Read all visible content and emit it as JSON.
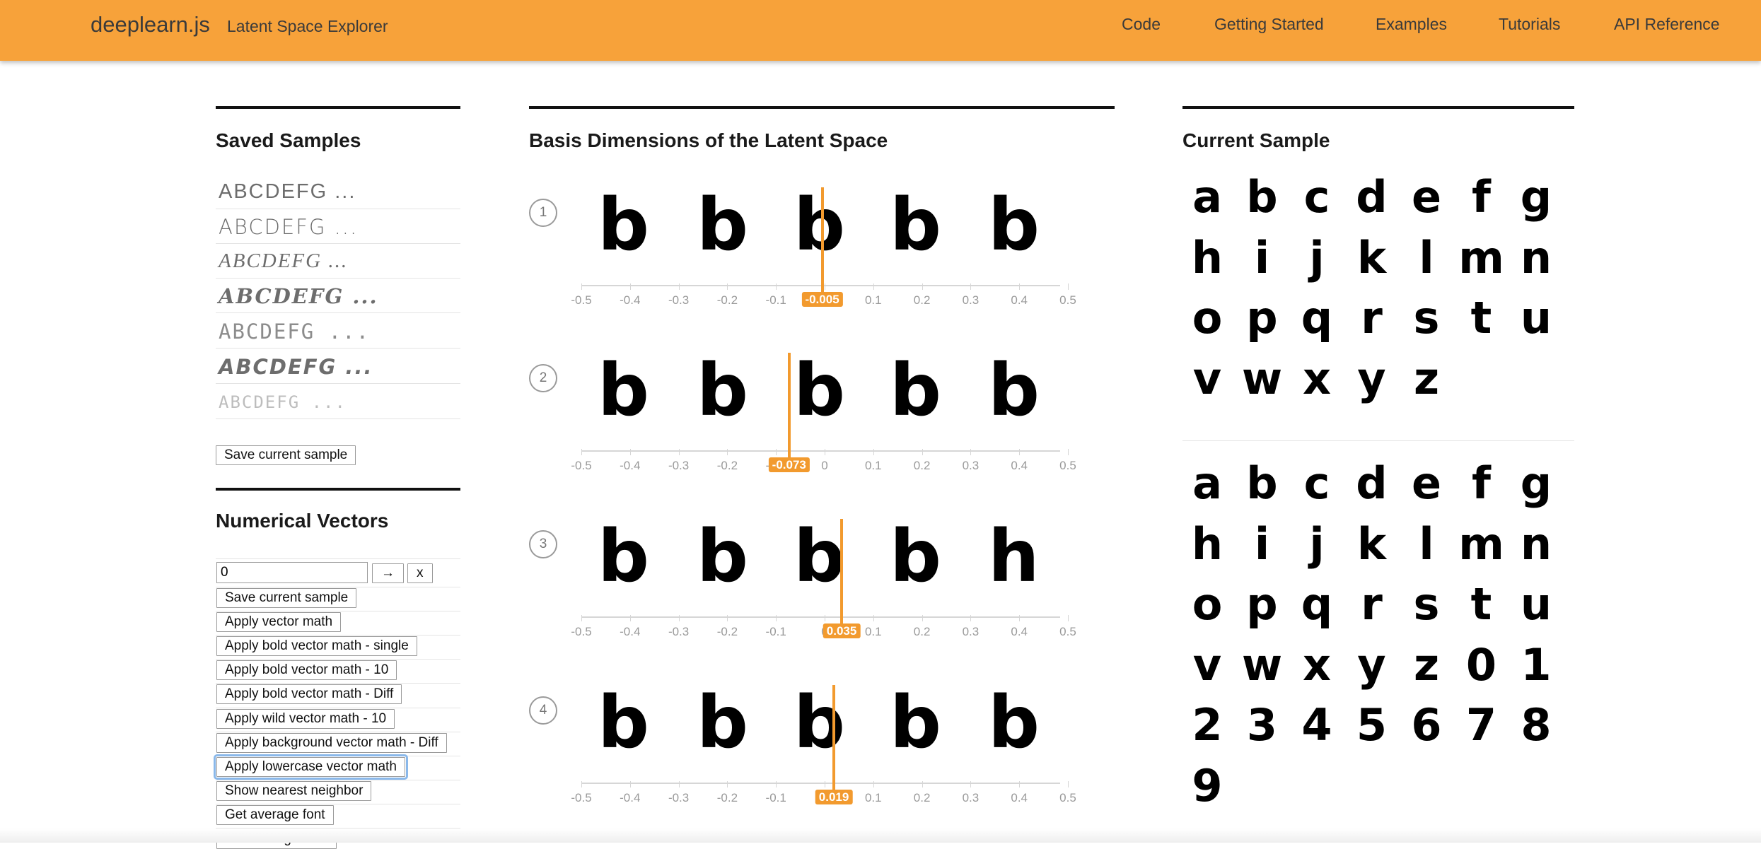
{
  "header": {
    "brand": "deeplearn.js",
    "subtitle": "Latent Space Explorer",
    "nav": [
      "Code",
      "Getting Started",
      "Examples",
      "Tutorials",
      "API Reference"
    ]
  },
  "saved_samples": {
    "title": "Saved Samples",
    "items": [
      "ABCDEFG ...",
      "ABCDEFG ...",
      "ABCDEFG ...",
      "ABCDEFG ...",
      "ABCDEFG ...",
      "ABCDEFG ...",
      "ABCDEFG ..."
    ],
    "save_button": "Save current sample"
  },
  "numerical_vectors": {
    "title": "Numerical Vectors",
    "input_value": "0",
    "go_button": "→",
    "clear_button": "x",
    "buttons": [
      "Save current sample",
      "Apply vector math",
      "Apply bold vector math - single",
      "Apply bold vector math - 10",
      "Apply bold vector math - Diff",
      "Apply wild vector math - 10",
      "Apply background vector math - Diff",
      "Apply lowercase vector math",
      "Show nearest neighbor",
      "Get average font",
      "Get average bold"
    ],
    "focused_index": 7
  },
  "basis": {
    "title": "Basis Dimensions of the Latent Space",
    "tick_labels": [
      "-0.5",
      "-0.4",
      "-0.3",
      "-0.2",
      "-0.1",
      "0",
      "0.1",
      "0.2",
      "0.3",
      "0.4",
      "0.5"
    ],
    "dimensions": [
      {
        "index": "1",
        "glyphs": [
          "b",
          "b",
          "b",
          "b",
          "b"
        ],
        "value": -0.005,
        "value_label": "-0.005"
      },
      {
        "index": "2",
        "glyphs": [
          "b",
          "b",
          "b",
          "b",
          "b"
        ],
        "value": -0.073,
        "value_label": "-0.073"
      },
      {
        "index": "3",
        "glyphs": [
          "b",
          "b",
          "b",
          "b",
          "h"
        ],
        "value": 0.035,
        "value_label": "0.035"
      },
      {
        "index": "4",
        "glyphs": [
          "b",
          "b",
          "b",
          "b",
          "b"
        ],
        "value": 0.019,
        "value_label": "0.019"
      }
    ]
  },
  "current_sample": {
    "title": "Current Sample",
    "lowercase": [
      "a",
      "b",
      "c",
      "d",
      "e",
      "f",
      "g",
      "h",
      "i",
      "j",
      "k",
      "l",
      "m",
      "n",
      "o",
      "p",
      "q",
      "r",
      "s",
      "t",
      "u",
      "v",
      "w",
      "x",
      "y",
      "z"
    ],
    "mixed": [
      "a",
      "b",
      "c",
      "d",
      "e",
      "f",
      "g",
      "h",
      "i",
      "j",
      "k",
      "l",
      "m",
      "n",
      "o",
      "p",
      "q",
      "r",
      "s",
      "t",
      "u",
      "v",
      "w",
      "x",
      "y",
      "z",
      "0",
      "1",
      "2",
      "3",
      "4",
      "5",
      "6",
      "7",
      "8",
      "9"
    ]
  }
}
